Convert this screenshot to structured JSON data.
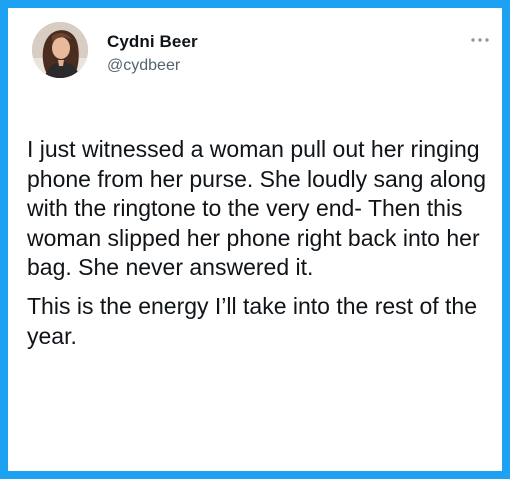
{
  "tweet": {
    "author": {
      "name": "Cydni Beer",
      "handle": "@cydbeer",
      "avatar_icon": "profile-photo"
    },
    "more_icon": "more-horizontal-icon",
    "paragraphs": [
      "I just witnessed a woman pull out her ringing phone from her purse. She loudly sang along with the ringtone to the very end- Then this woman slipped her phone right back into her bag. She never answered it.",
      "This is the energy I’ll take into the rest of the year."
    ]
  },
  "colors": {
    "background_border": "#1da1f2",
    "text_primary": "#0f1419",
    "text_secondary": "#536471"
  }
}
